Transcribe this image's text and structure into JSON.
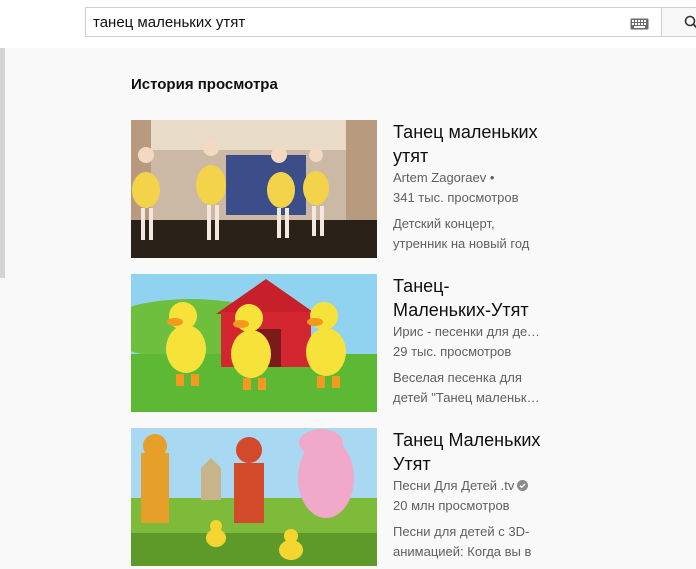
{
  "search": {
    "value": "танец маленьких утят"
  },
  "section": {
    "title": "История просмотра"
  },
  "videos": [
    {
      "title": "Танец маленьких утят",
      "channel": "Artem Zagoraev •",
      "views": "341 тыс. просмотров",
      "description": "Детский концерт, утренник на новый год"
    },
    {
      "title": "Танец-Маленьких-Утят",
      "channel": "Ирис - песенки для детей",
      "views": "29 тыс. просмотров",
      "description": "Веселая песенка для детей \"Танец маленьких утят\""
    },
    {
      "title": "Танец Маленьких Утят",
      "channel": "Песни Для Детей .tv",
      "views": "20 млн просмотров",
      "description": "Песни для детей с 3D-анимацией: Когда вы в"
    }
  ],
  "icons": {
    "keyboard": "keyboard-icon",
    "search": "search-icon",
    "verified": "verified-icon"
  }
}
